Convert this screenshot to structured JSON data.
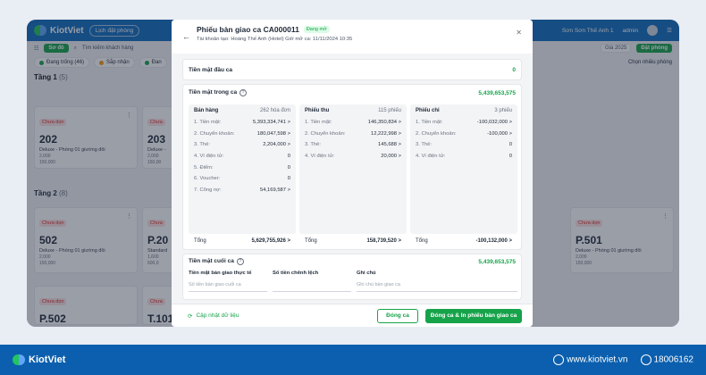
{
  "app": {
    "name": "KiotViet",
    "nav_booking": "Lịch đặt phòng",
    "branch": "Sơn Sơn Thế Anh 1",
    "user": "admin"
  },
  "toolbar": {
    "view": "Sơ đồ",
    "search_placeholder": "Tìm kiếm khách hàng",
    "price": "Giá 2025",
    "book": "Đặt phòng",
    "multi": "Chọn nhiều phòng"
  },
  "filters": [
    {
      "label": "Đang trống (46)",
      "color": "#16a34a"
    },
    {
      "label": "Sắp nhận",
      "color": "#f59e0b"
    },
    {
      "label": "Đan",
      "color": "#16a34a"
    }
  ],
  "floors": {
    "f1": {
      "name": "Tầng 1",
      "count": "(5)"
    },
    "f2": {
      "name": "Tầng 2",
      "count": "(8)"
    }
  },
  "rooms": [
    {
      "status": "Chưa dọn",
      "name": "202",
      "type": "Deluxe - Phòng 01 giường đôi",
      "p1": "2,000",
      "p2": "150,000"
    },
    {
      "status": "Chưa",
      "name": "203",
      "type": "Deluxe -",
      "p1": "2,000",
      "p2": "150,00"
    },
    {
      "status": "Chưa dọn",
      "name": "502",
      "type": "Deluxe - Phòng 01 giường đôi",
      "p1": "2,000",
      "p2": "150,000"
    },
    {
      "status": "Chưa",
      "name": "P.20",
      "type": "Standard",
      "p1": "1,600",
      "p2": "600,0"
    },
    {
      "status": "Chưa dọn",
      "name": "P.501",
      "type": "Deluxe - Phòng 01 giường đôi",
      "p1": "2,000",
      "p2": "150,000"
    },
    {
      "status": "Chưa dọn",
      "name": "P.502",
      "type": "",
      "p1": "",
      "p2": ""
    },
    {
      "status": "Chưa",
      "name": "T.101",
      "type": "",
      "p1": "",
      "p2": ""
    }
  ],
  "modal": {
    "title": "Phiếu bàn giao ca CA000011",
    "status": "Đang mở",
    "subtitle": "Tài khoản tạo: Hoàng Thế Anh (Hotel)   Giờ mở ca: 11/11/2024 10:35",
    "opening_label": "Tiền mặt đầu ca",
    "opening_value": "0",
    "inshift_label": "Tiền mặt trong ca",
    "inshift_value": "5,439,653,575",
    "sales": {
      "title": "Bán hàng",
      "count": "262 hóa đơn",
      "rows": [
        {
          "l": "1. Tiền mặt:",
          "v": "5,393,334,741 >"
        },
        {
          "l": "2. Chuyển khoản:",
          "v": "180,047,598 >"
        },
        {
          "l": "3. Thẻ:",
          "v": "2,204,000 >"
        },
        {
          "l": "4. Ví điện tử:",
          "v": "0"
        },
        {
          "l": "5. Điểm:",
          "v": "0"
        },
        {
          "l": "6. Voucher:",
          "v": "0"
        },
        {
          "l": "7. Công nợ:",
          "v": "54,169,587 >"
        }
      ],
      "total_label": "Tổng",
      "total": "5,629,755,926 >"
    },
    "receipts": {
      "title": "Phiếu thu",
      "count": "115 phiếu",
      "rows": [
        {
          "l": "1. Tiền mặt:",
          "v": "146,350,834 >"
        },
        {
          "l": "2. Chuyển khoản:",
          "v": "12,222,998 >"
        },
        {
          "l": "3. Thẻ:",
          "v": "145,688 >"
        },
        {
          "l": "4. Ví điện tử:",
          "v": "20,000 >"
        }
      ],
      "total_label": "Tổng",
      "total": "158,739,520 >"
    },
    "payments": {
      "title": "Phiếu chi",
      "count": "3 phiếu",
      "rows": [
        {
          "l": "1. Tiền mặt:",
          "v": "-100,032,000 >"
        },
        {
          "l": "2. Chuyển khoản:",
          "v": "-100,000 >"
        },
        {
          "l": "3. Thẻ:",
          "v": "0"
        },
        {
          "l": "4. Ví điện tử:",
          "v": "0"
        }
      ],
      "total_label": "Tổng",
      "total": "-100,132,000 >"
    },
    "closing_label": "Tiền mặt cuối ca",
    "closing_value": "5,439,653,575",
    "f_actual": "Tiền mặt bàn giao thực tế",
    "f_actual_ph": "Số tiền bàn giao cuối ca",
    "f_diff": "Số tiền chênh lệch",
    "f_note": "Ghi chú",
    "f_note_ph": "Ghi chú bàn giao ca",
    "refresh": "Cập nhật dữ liệu",
    "close_btn": "Đóng ca",
    "print_btn": "Đóng ca & In phiếu bàn giao ca"
  },
  "footer": {
    "brand": "KiotViet",
    "site": "www.kiotviet.vn",
    "phone": "18006162"
  }
}
